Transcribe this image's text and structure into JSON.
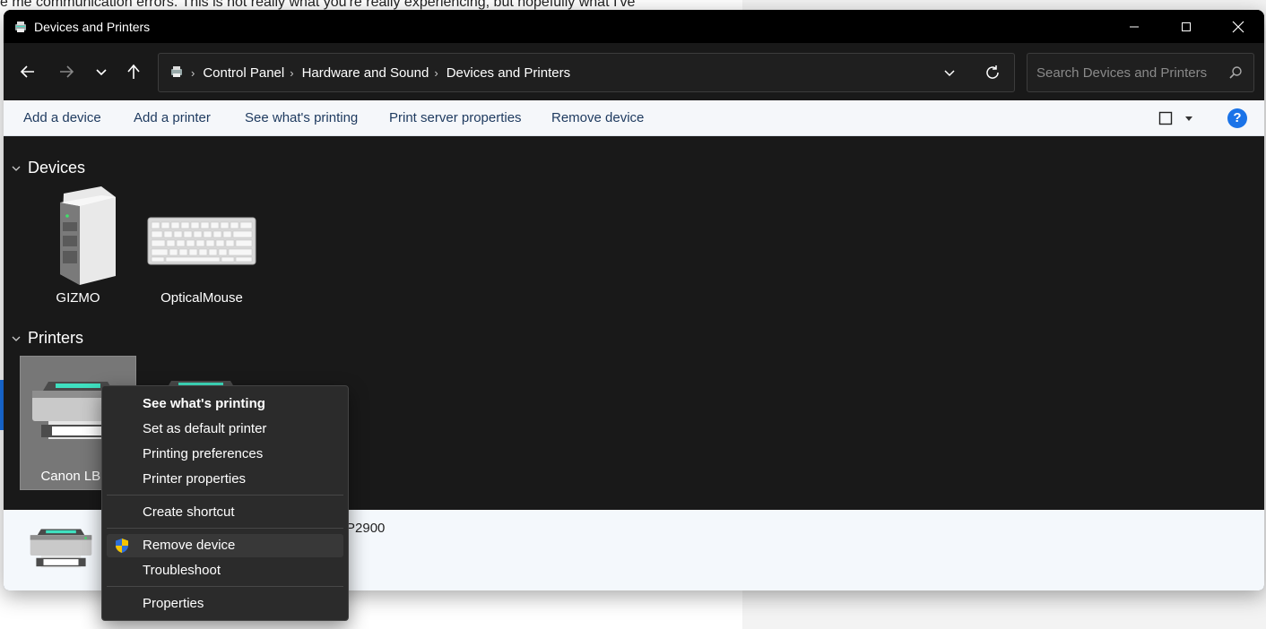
{
  "background": {
    "text": "e me communication errors. This is not really what you're really experiencing, but hopefully what I've"
  },
  "window": {
    "title": "Devices and Printers"
  },
  "nav": {
    "breadcrumb": [
      "Control Panel",
      "Hardware and Sound",
      "Devices and Printers"
    ],
    "search_placeholder": "Search Devices and Printers"
  },
  "commands": {
    "add_device": "Add a device",
    "add_printer": "Add a printer",
    "see_printing": "See what's printing",
    "print_server": "Print server properties",
    "remove_device": "Remove device",
    "help": "?"
  },
  "groups": {
    "devices": {
      "title": "Devices",
      "items": [
        {
          "label": "GIZMO",
          "icon": "computer-tower-icon"
        },
        {
          "label": "OpticalMouse",
          "icon": "keyboard-icon"
        }
      ]
    },
    "printers": {
      "title": "Printers",
      "items": [
        {
          "label": "Canon LBP2",
          "icon": "printer-icon"
        },
        {
          "label": "",
          "icon": "printer-icon"
        }
      ]
    }
  },
  "details": {
    "name": "P2900"
  },
  "context_menu": {
    "items": [
      {
        "label": "See what's printing",
        "bold": true
      },
      {
        "label": "Set as default printer"
      },
      {
        "label": "Printing preferences"
      },
      {
        "label": "Printer properties"
      },
      {
        "label": "Create shortcut"
      },
      {
        "label": "Remove device",
        "icon": "uac-shield-icon",
        "hover": true
      },
      {
        "label": "Troubleshoot"
      },
      {
        "label": "Properties"
      }
    ]
  },
  "colors": {
    "accent": "#1a73e8",
    "window_bg": "#191919",
    "commandbar_bg": "#f5f7fa",
    "command_text": "#1e3a5f",
    "teal_glow": "#3fe0c0"
  }
}
